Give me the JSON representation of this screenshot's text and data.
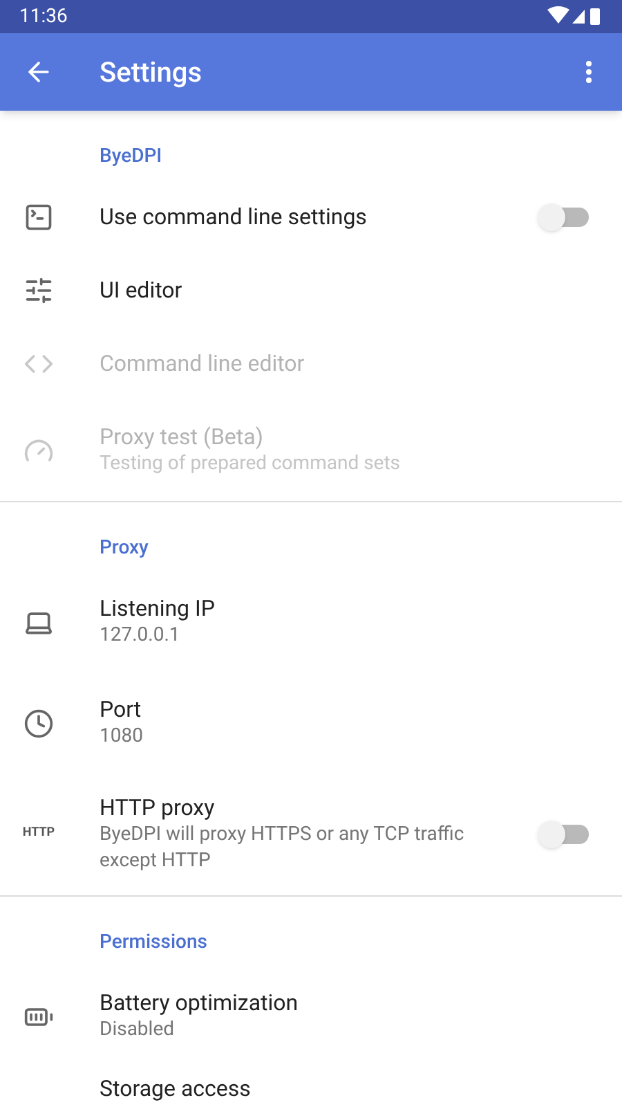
{
  "status_bar": {
    "time": "11:36"
  },
  "app_bar": {
    "title": "Settings"
  },
  "sections": [
    {
      "title": "ByeDPI",
      "items": [
        {
          "kind": "switch",
          "title": "Use command line settings",
          "on": false,
          "disabled": false
        },
        {
          "kind": "plain",
          "title": "UI editor",
          "disabled": false
        },
        {
          "kind": "plain",
          "title": "Command line editor",
          "disabled": true
        },
        {
          "kind": "plain",
          "title": "Proxy test (Beta)",
          "summary": "Testing of prepared command sets",
          "disabled": true
        }
      ]
    },
    {
      "title": "Proxy",
      "items": [
        {
          "kind": "plain",
          "title": "Listening IP",
          "summary": "127.0.0.1",
          "disabled": false
        },
        {
          "kind": "plain",
          "title": "Port",
          "summary": "1080",
          "disabled": false
        },
        {
          "kind": "switch",
          "icon_text": "HTTP",
          "title": "HTTP proxy",
          "summary": "ByeDPI will proxy HTTPS or any TCP traffic except HTTP",
          "on": false,
          "disabled": false
        }
      ]
    },
    {
      "title": "Permissions",
      "items": [
        {
          "kind": "plain",
          "title": "Battery optimization",
          "summary": "Disabled",
          "disabled": false
        },
        {
          "kind": "plain",
          "title": "Storage access",
          "disabled": false
        }
      ]
    }
  ]
}
